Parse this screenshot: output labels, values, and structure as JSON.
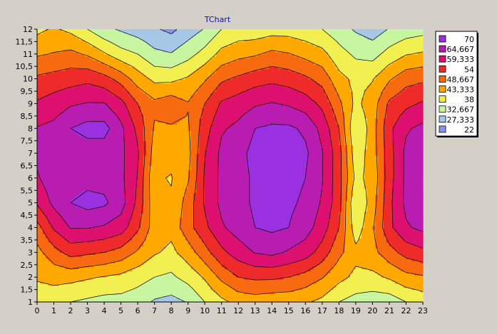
{
  "chart_data": {
    "type": "heatmap",
    "subtype": "contour",
    "title": "TChart",
    "xlabel": "",
    "ylabel": "",
    "x": [
      0,
      1,
      2,
      3,
      4,
      5,
      6,
      7,
      8,
      9,
      10,
      11,
      12,
      13,
      14,
      15,
      16,
      17,
      18,
      19,
      20,
      21,
      22,
      23
    ],
    "y": [
      1,
      1.5,
      2,
      2.5,
      3,
      3.5,
      4,
      4.5,
      5,
      5.5,
      6,
      6.5,
      7,
      7.5,
      8,
      8.5,
      9,
      9.5,
      10,
      10.5,
      11,
      11.5,
      12
    ],
    "x_ticks": [
      "0",
      "1",
      "2",
      "3",
      "4",
      "5",
      "6",
      "7",
      "8",
      "9",
      "10",
      "11",
      "12",
      "13",
      "14",
      "15",
      "16",
      "17",
      "18",
      "19",
      "20",
      "21",
      "22",
      "23"
    ],
    "y_ticks": [
      "1",
      "1,5",
      "2",
      "2,5",
      "3",
      "3,5",
      "4",
      "4,5",
      "5",
      "5,5",
      "6",
      "6,5",
      "7",
      "7,5",
      "8",
      "8,5",
      "9",
      "9,5",
      "10",
      "10,5",
      "11",
      "11,5",
      "12"
    ],
    "xlim": [
      0,
      23
    ],
    "ylim": [
      1,
      12
    ],
    "grid": false,
    "legend_position": "right",
    "levels": [
      22,
      27.333,
      32.667,
      38,
      43.333,
      48.667,
      54,
      59.333,
      64.667,
      70
    ],
    "legend": [
      {
        "label": "70",
        "color": "#9b30e0"
      },
      {
        "label": "64,667",
        "color": "#b81cb0"
      },
      {
        "label": "59,333",
        "color": "#dd1070"
      },
      {
        "label": "54",
        "color": "#ee2a2a"
      },
      {
        "label": "48,667",
        "color": "#f76a10"
      },
      {
        "label": "43,333",
        "color": "#ffa800"
      },
      {
        "label": "38",
        "color": "#f2f050"
      },
      {
        "label": "32,667",
        "color": "#c8f5a0"
      },
      {
        "label": "27,333",
        "color": "#a6c8e6"
      },
      {
        "label": "22",
        "color": "#8a92ee"
      }
    ],
    "columns": [
      {
        "x": 0,
        "values": [
          38,
          40,
          44,
          47,
          52,
          60,
          64,
          66,
          65,
          60,
          55,
          48,
          42
        ]
      },
      {
        "x": 1,
        "values": [
          35,
          40,
          45,
          52,
          60,
          66,
          68,
          67,
          66,
          62,
          56,
          49,
          44
        ]
      },
      {
        "x": 2,
        "values": [
          33,
          38,
          45,
          56,
          65,
          70,
          69,
          68,
          70,
          64,
          57,
          50,
          42
        ]
      },
      {
        "x": 3,
        "values": [
          32,
          37,
          44,
          55,
          65,
          72,
          68,
          67,
          72,
          65,
          58,
          48,
          38
        ]
      },
      {
        "x": 4,
        "values": [
          30,
          36,
          43,
          54,
          64,
          71,
          68,
          67,
          72,
          65,
          56,
          44,
          34
        ]
      },
      {
        "x": 5,
        "values": [
          30,
          36,
          42,
          52,
          62,
          67,
          66,
          66,
          66,
          61,
          52,
          40,
          32
        ]
      },
      {
        "x": 6,
        "values": [
          30,
          35,
          40,
          48,
          55,
          58,
          59,
          60,
          58,
          54,
          46,
          38,
          30
        ]
      },
      {
        "x": 7,
        "values": [
          29,
          32,
          38,
          44,
          46,
          45,
          44,
          46,
          48,
          50,
          42,
          34,
          28
        ]
      },
      {
        "x": 8,
        "values": [
          27,
          31,
          37,
          42,
          45,
          44,
          43,
          45,
          48,
          52,
          42,
          33,
          26
        ]
      },
      {
        "x": 9,
        "values": [
          30,
          33,
          40,
          46,
          52,
          51,
          48,
          47,
          48,
          49,
          44,
          36,
          30
        ]
      },
      {
        "x": 10,
        "values": [
          35,
          38,
          44,
          52,
          58,
          60,
          60,
          59,
          57,
          54,
          48,
          40,
          33
        ]
      },
      {
        "x": 11,
        "values": [
          37,
          42,
          50,
          58,
          64,
          66,
          66,
          66,
          64,
          60,
          53,
          45,
          38
        ]
      },
      {
        "x": 12,
        "values": [
          38,
          45,
          54,
          62,
          67,
          68,
          68,
          68,
          66,
          62,
          55,
          47,
          40
        ]
      },
      {
        "x": 13,
        "values": [
          38,
          46,
          55,
          65,
          70,
          71,
          71,
          72,
          70,
          64,
          57,
          48,
          40
        ]
      },
      {
        "x": 14,
        "values": [
          37,
          45,
          55,
          66,
          71,
          72,
          73,
          73,
          71,
          65,
          58,
          50,
          41
        ]
      },
      {
        "x": 15,
        "values": [
          37,
          45,
          54,
          64,
          70,
          71,
          72,
          73,
          71,
          64,
          57,
          49,
          41
        ]
      },
      {
        "x": 16,
        "values": [
          37,
          44,
          52,
          62,
          67,
          69,
          70,
          71,
          69,
          62,
          55,
          47,
          40
        ]
      },
      {
        "x": 17,
        "values": [
          36,
          42,
          49,
          57,
          62,
          64,
          65,
          65,
          63,
          58,
          52,
          45,
          38
        ]
      },
      {
        "x": 18,
        "values": [
          33,
          38,
          45,
          50,
          54,
          56,
          56,
          56,
          54,
          50,
          45,
          40,
          35
        ]
      },
      {
        "x": 19,
        "values": [
          31,
          36,
          42,
          45,
          40,
          38,
          42,
          40,
          38,
          42,
          42,
          37,
          32
        ]
      },
      {
        "x": 20,
        "values": [
          30,
          35,
          42,
          47,
          48,
          46,
          45,
          46,
          46,
          46,
          43,
          36,
          30
        ]
      },
      {
        "x": 21,
        "values": [
          30,
          35,
          44,
          52,
          58,
          58,
          57,
          57,
          58,
          55,
          48,
          40,
          33
        ]
      },
      {
        "x": 22,
        "values": [
          32,
          38,
          47,
          56,
          64,
          66,
          66,
          66,
          64,
          58,
          52,
          43,
          35
        ]
      },
      {
        "x": 23,
        "values": [
          34,
          40,
          48,
          58,
          66,
          68,
          68,
          68,
          66,
          60,
          53,
          44,
          36
        ]
      }
    ]
  }
}
